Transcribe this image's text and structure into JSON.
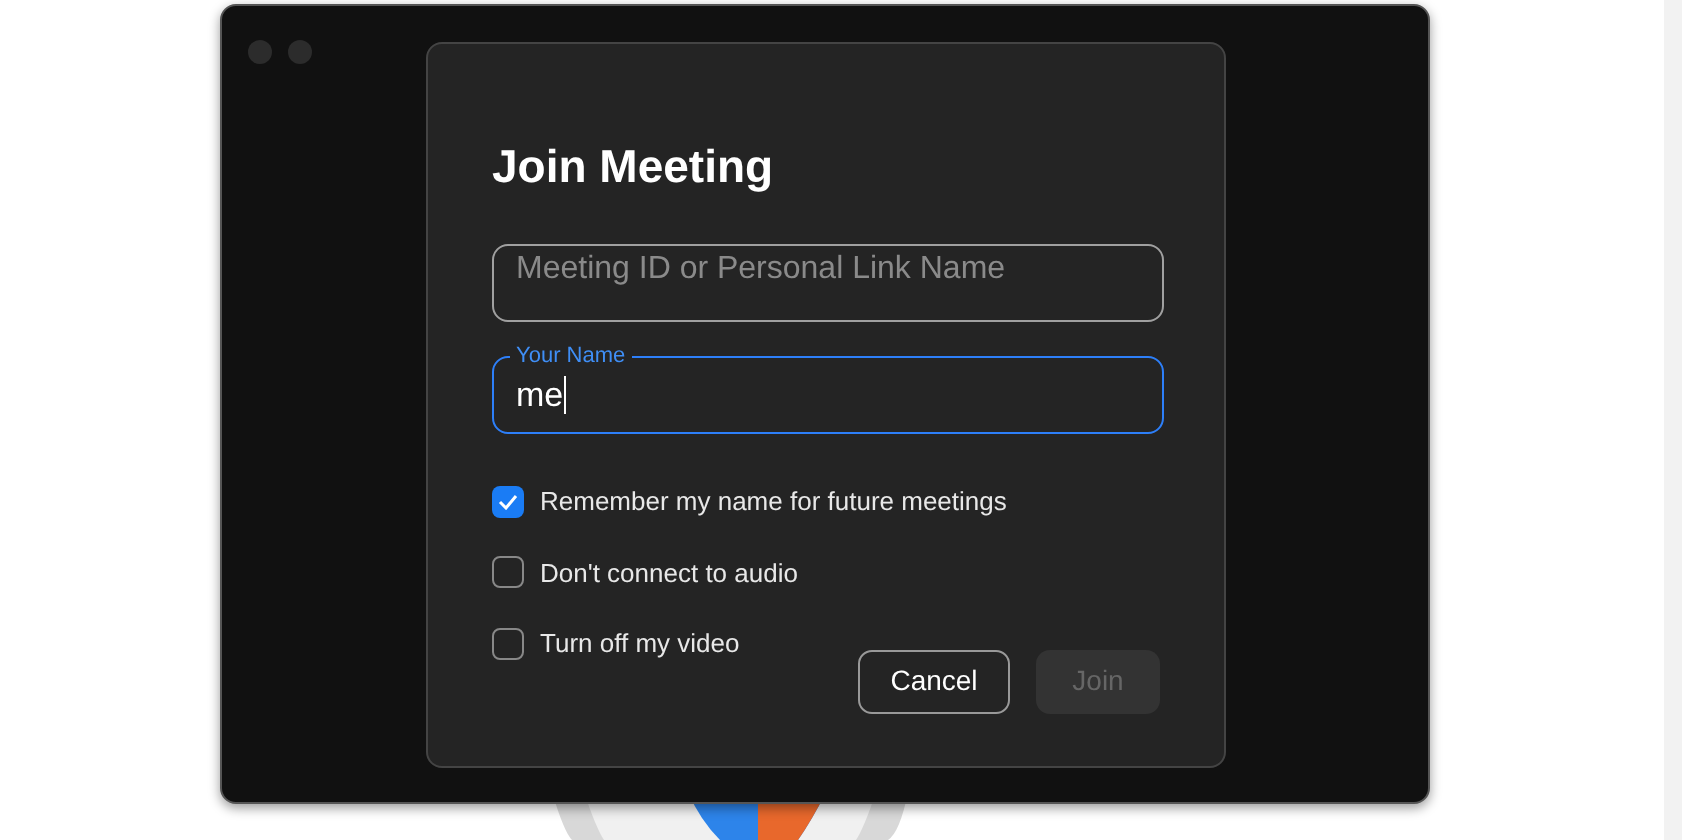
{
  "dialog": {
    "title": "Join Meeting",
    "fields": [
      {
        "placeholder": "Meeting ID or Personal Link Name",
        "focused": false
      },
      {
        "label": "Your Name",
        "value": "me",
        "focused": true
      }
    ],
    "checkboxes": [
      {
        "label": "Remember my name for future meetings",
        "checked": true
      },
      {
        "label": "Don't connect to audio",
        "checked": false
      },
      {
        "label": "Turn off my video",
        "checked": false
      }
    ],
    "buttons": [
      {
        "label": "Cancel",
        "disabled": false
      },
      {
        "label": "Join",
        "disabled": true
      }
    ]
  }
}
